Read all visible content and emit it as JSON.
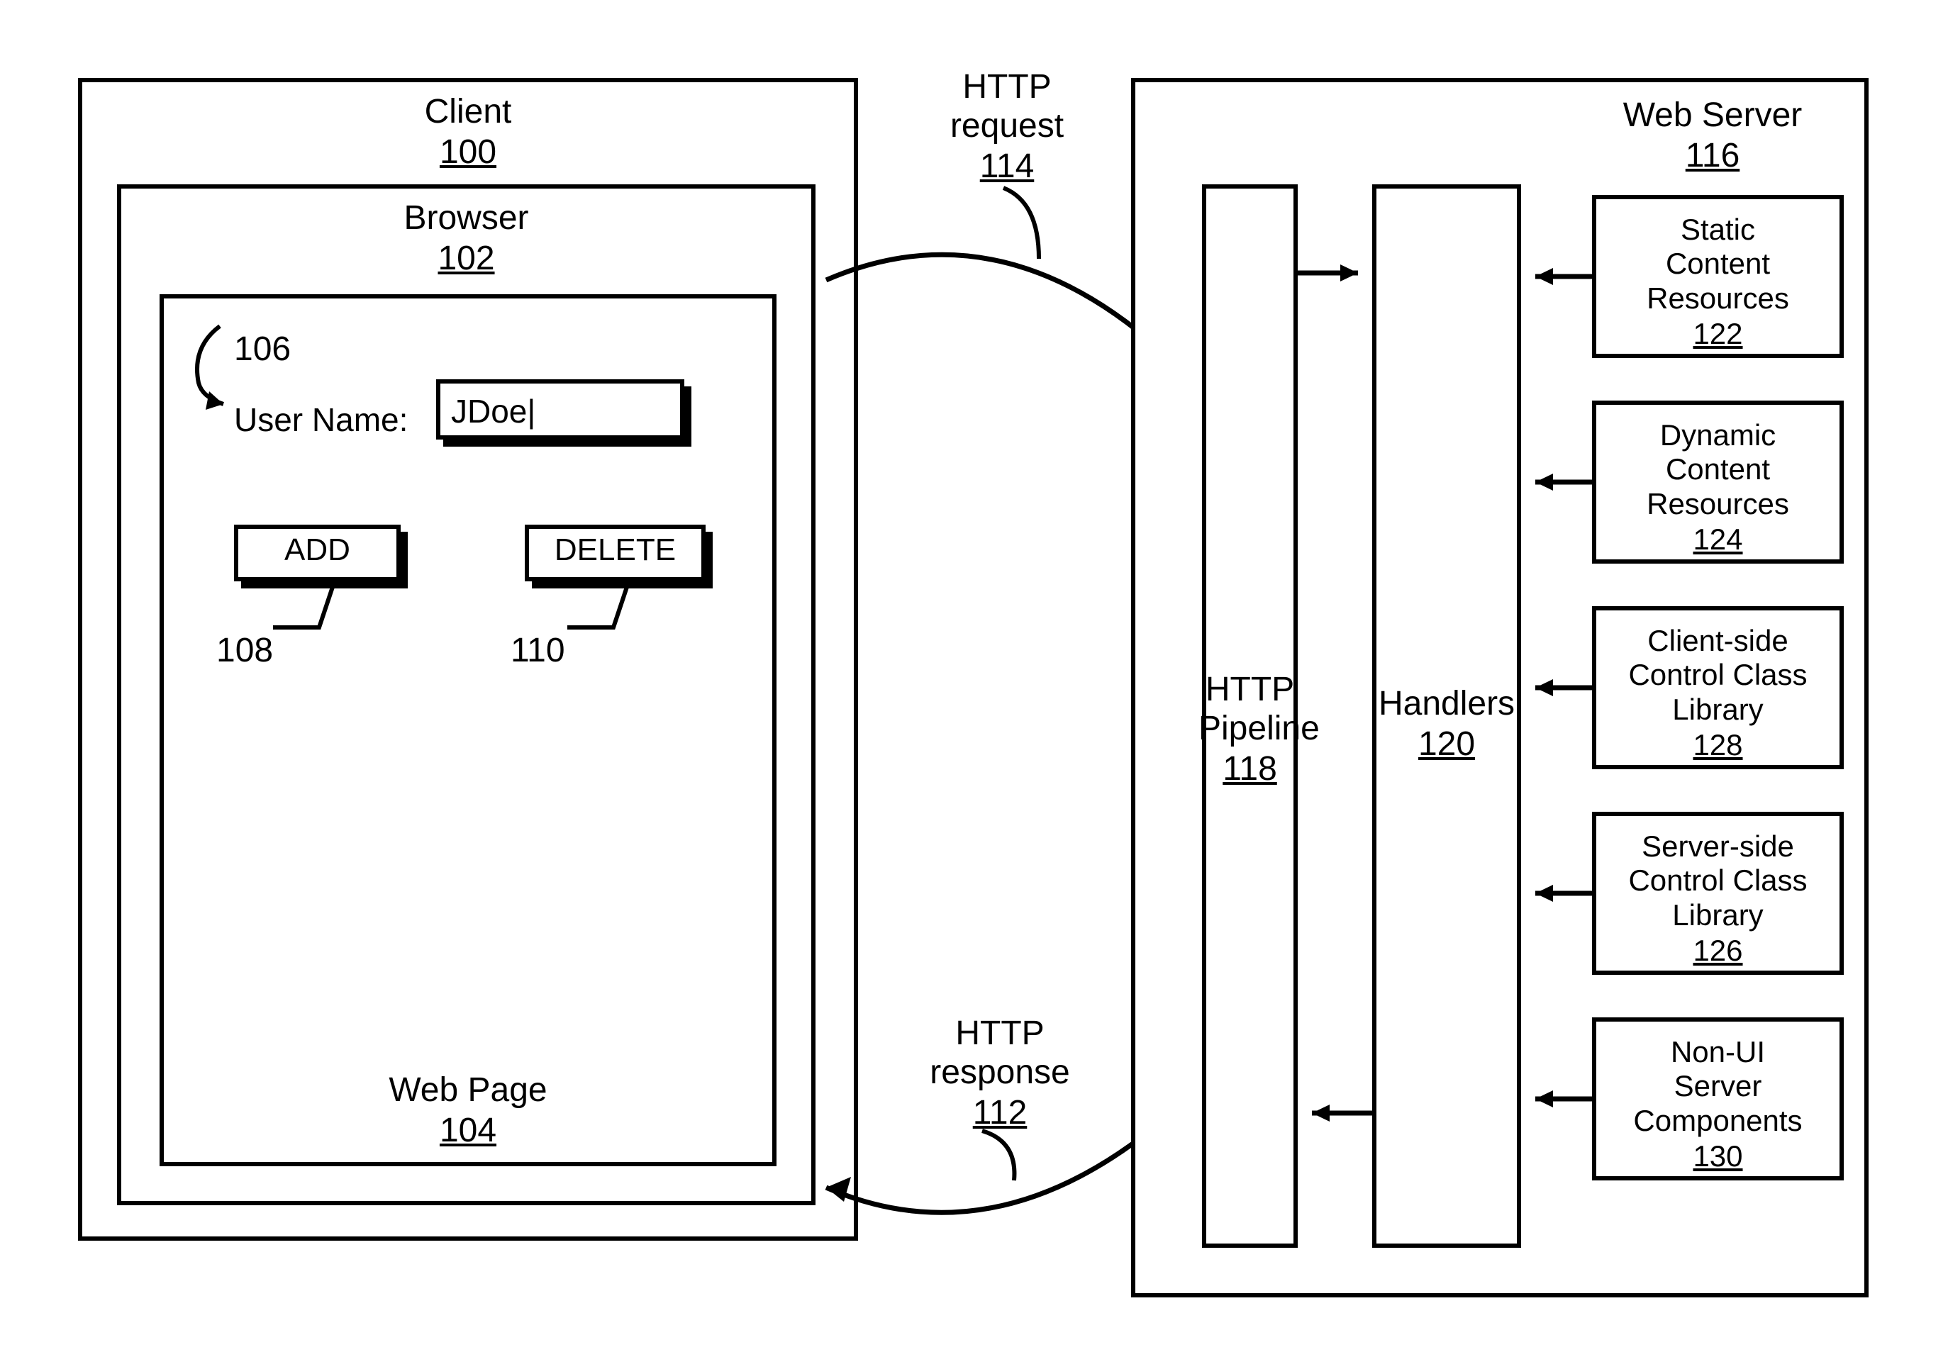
{
  "client": {
    "title": "Client",
    "num": "100"
  },
  "browser": {
    "title": "Browser",
    "num": "102"
  },
  "webpage": {
    "title": "Web Page",
    "num": "104"
  },
  "form": {
    "callout106": "106",
    "username_label": "User Name:",
    "username_value": "JDoe|",
    "add_label": "ADD",
    "delete_label": "DELETE",
    "callout108": "108",
    "callout110": "110"
  },
  "http_request": {
    "title": "HTTP\nrequest",
    "num": "114"
  },
  "http_response": {
    "title": "HTTP\nresponse",
    "num": "112"
  },
  "webserver": {
    "title": "Web Server",
    "num": "116"
  },
  "pipeline": {
    "title": "HTTP\nPipeline",
    "num": "118"
  },
  "handlers": {
    "title": "Handlers",
    "num": "120"
  },
  "resources": {
    "r1": {
      "title": "Static\nContent\nResources",
      "num": "122"
    },
    "r2": {
      "title": "Dynamic\nContent\nResources",
      "num": "124"
    },
    "r3": {
      "title": "Client-side\nControl Class\nLibrary",
      "num": "128"
    },
    "r4": {
      "title": "Server-side\nControl Class\nLibrary",
      "num": "126"
    },
    "r5": {
      "title": "Non-UI\nServer\nComponents",
      "num": "130"
    }
  }
}
